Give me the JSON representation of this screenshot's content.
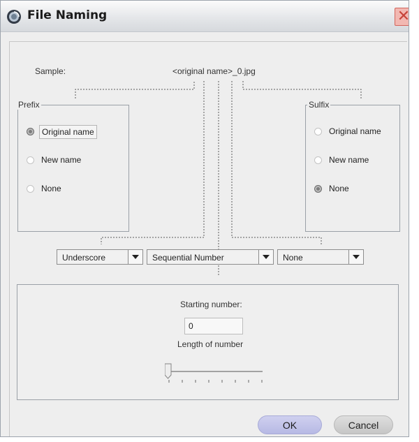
{
  "window": {
    "title": "File Naming",
    "app_icon": "app-logo-icon",
    "close_icon": "close-icon",
    "close_glyph": "✕"
  },
  "sample": {
    "label": "Sample:",
    "value": "<original name>_0.jpg"
  },
  "prefix": {
    "title": "Prefix",
    "options": [
      "Original name",
      "New name",
      "None"
    ],
    "selected": "Original name"
  },
  "suffix": {
    "title": "Sulfix",
    "options": [
      "Original name",
      "New name",
      "None"
    ],
    "selected": "None"
  },
  "separators": {
    "left": "Underscore",
    "middle": "Sequential Number",
    "right": "None"
  },
  "numbering": {
    "starting_label": "Starting number:",
    "starting_value": "0",
    "length_label": "Length of number",
    "length_fraction": 0
  },
  "buttons": {
    "ok": "OK",
    "cancel": "Cancel"
  },
  "colors": {
    "ok_button": "#b7b9e4",
    "cancel_button": "#c6c6c6",
    "close_button": "#f2b8b2"
  }
}
